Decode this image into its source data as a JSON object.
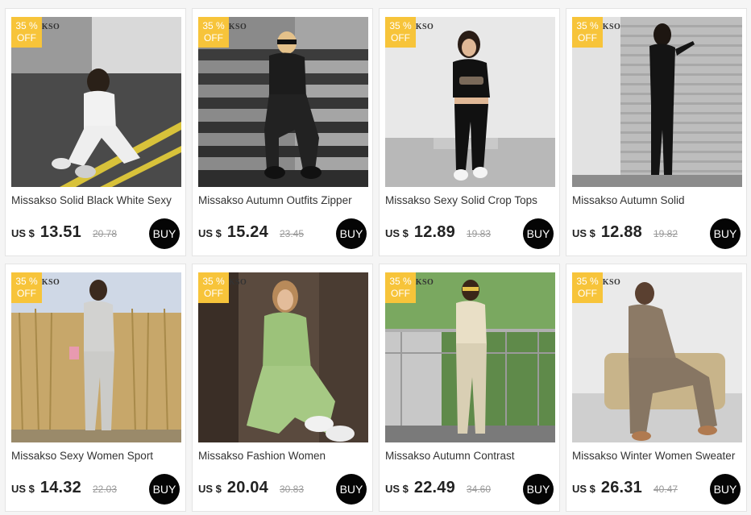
{
  "badge": {
    "percent": "35 %",
    "off": "OFF"
  },
  "watermark": "AKSO",
  "currency": "US $",
  "buy_label": "BUY",
  "products": [
    {
      "title": "Missakso Solid Black White Sexy",
      "price": "13.51",
      "old_price": "20.78"
    },
    {
      "title": "Missakso Autumn Outfits Zipper",
      "price": "15.24",
      "old_price": "23.45"
    },
    {
      "title": "Missakso Sexy Solid Crop Tops",
      "price": "12.89",
      "old_price": "19.83"
    },
    {
      "title": "Missakso Autumn Solid",
      "price": "12.88",
      "old_price": "19.82"
    },
    {
      "title": "Missakso Sexy Women Sport",
      "price": "14.32",
      "old_price": "22.03"
    },
    {
      "title": "Missakso Fashion Women",
      "price": "20.04",
      "old_price": "30.83"
    },
    {
      "title": "Missakso Autumn Contrast",
      "price": "22.49",
      "old_price": "34.60"
    },
    {
      "title": "Missakso Winter Women Sweater",
      "price": "26.31",
      "old_price": "40.47"
    }
  ]
}
